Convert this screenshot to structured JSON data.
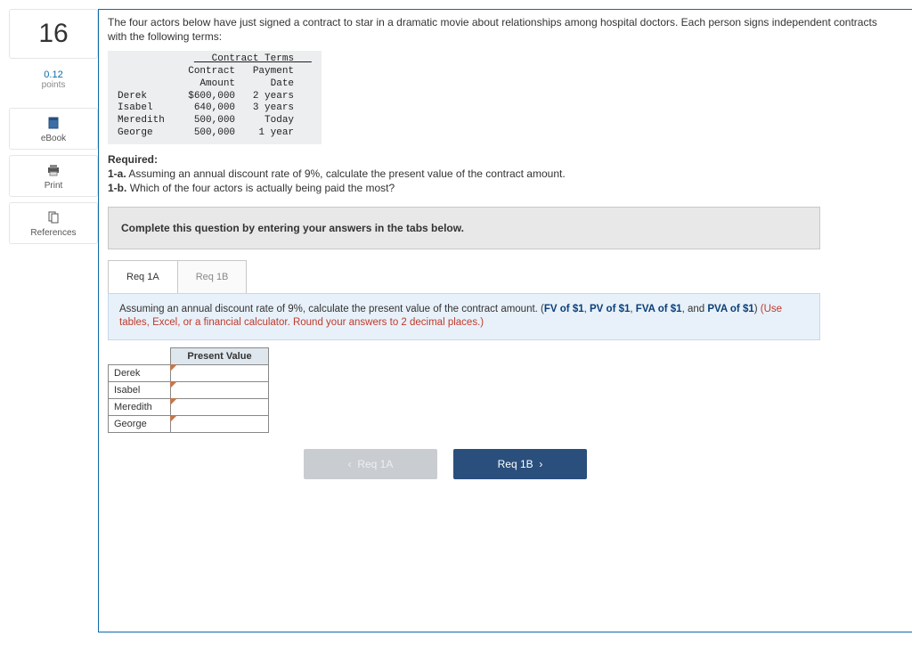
{
  "sidebar": {
    "question_number": "16",
    "points_value": "0.12",
    "points_label": "points",
    "tools": {
      "ebook": "eBook",
      "print": "Print",
      "references": "References"
    }
  },
  "prompt": {
    "intro": "The four actors below have just signed a contract to star in a dramatic movie about relationships among hospital doctors. Each person signs independent contracts with the following terms:"
  },
  "contract_terms": {
    "title": "Contract Terms",
    "col_amount_top": "Contract",
    "col_amount_bot": "Amount",
    "col_date_top": "Payment",
    "col_date_bot": "Date",
    "rows": [
      {
        "name": "Derek",
        "amount": "$600,000",
        "date": "2 years"
      },
      {
        "name": "Isabel",
        "amount": "640,000",
        "date": "3 years"
      },
      {
        "name": "Meredith",
        "amount": "500,000",
        "date": "Today"
      },
      {
        "name": "George",
        "amount": "500,000",
        "date": "1 year"
      }
    ]
  },
  "required": {
    "label": "Required:",
    "a_tag": "1-a.",
    "a_text": "Assuming an annual discount rate of 9%, calculate the present value of the contract amount.",
    "b_tag": "1-b.",
    "b_text": "Which of the four actors is actually being paid the most?"
  },
  "instruction_bar": "Complete this question by entering your answers in the tabs below.",
  "tabs": {
    "a": "Req 1A",
    "b": "Req 1B"
  },
  "tab_content": {
    "lead": "Assuming an annual discount rate of 9%, calculate the present value of the contract amount. (",
    "fv": "FV of $1",
    "sep1": ", ",
    "pv": "PV of $1",
    "sep2": ", ",
    "fva": "FVA of $1",
    "sep3": ", and ",
    "pva": "PVA of $1",
    "close": ") ",
    "hint": "(Use tables, Excel, or a financial calculator. Round your answers to 2 decimal places.)"
  },
  "answer_table": {
    "header": "Present Value",
    "rows": [
      "Derek",
      "Isabel",
      "Meredith",
      "George"
    ]
  },
  "nav": {
    "prev": "Req 1A",
    "next": "Req 1B"
  }
}
